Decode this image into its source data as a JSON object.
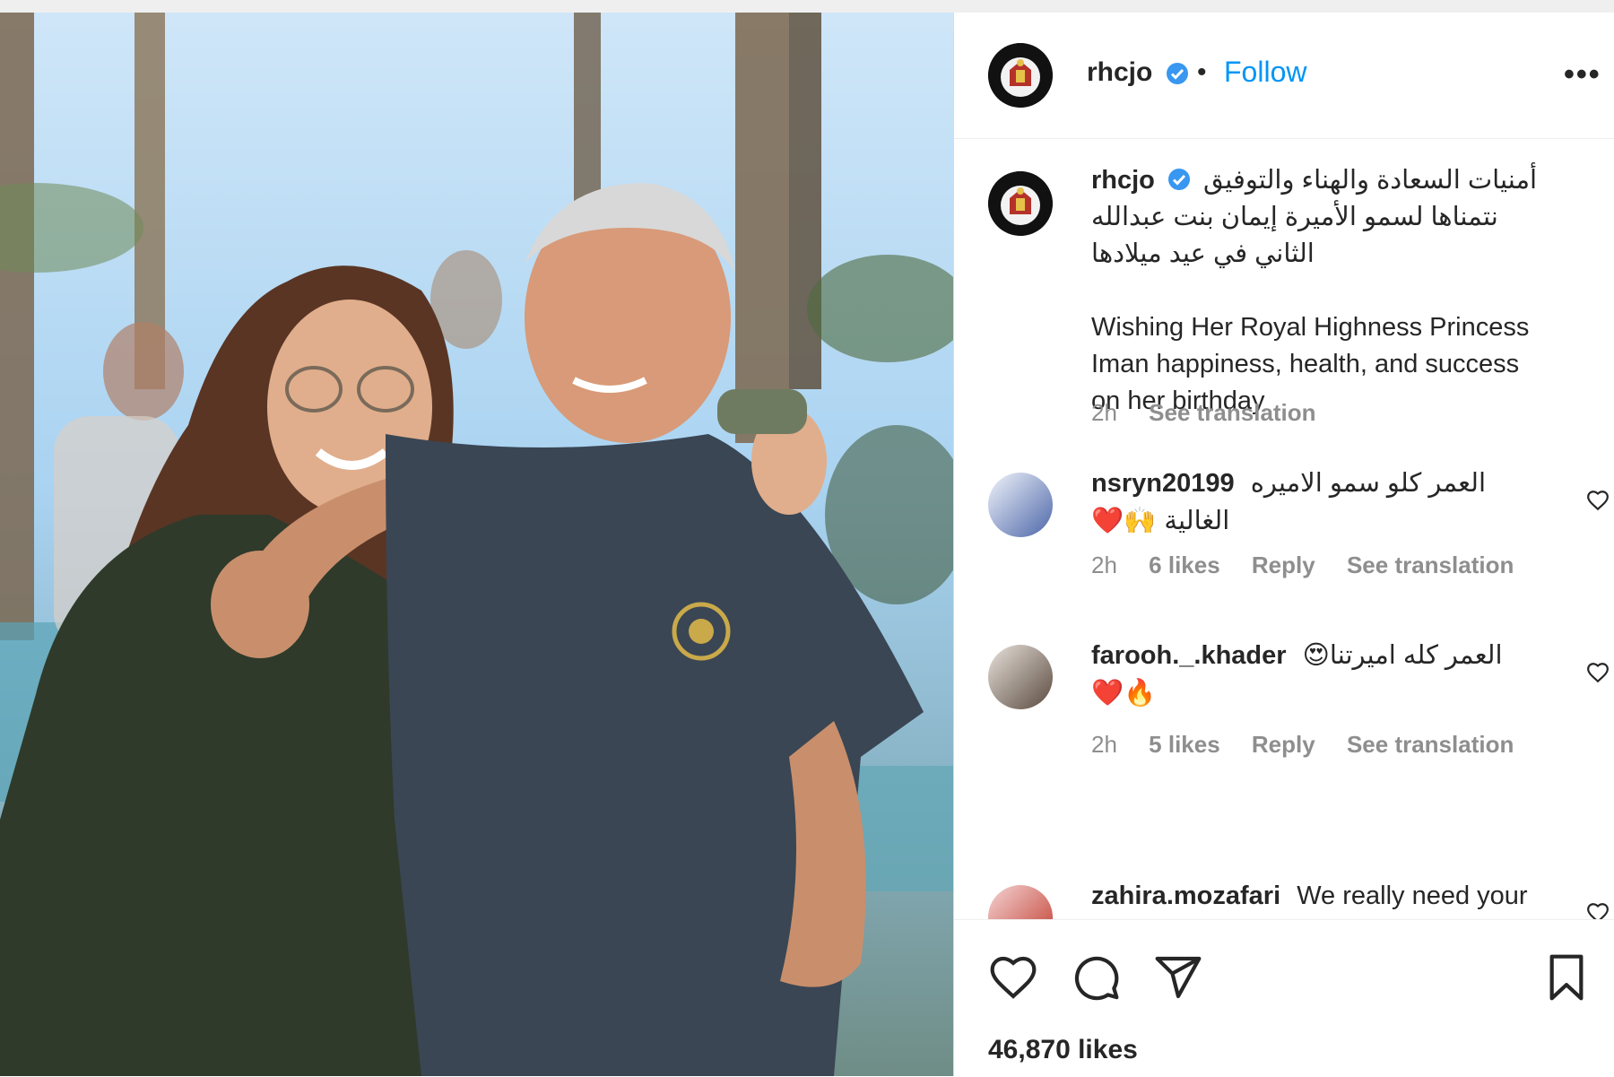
{
  "post": {
    "username": "rhcjo",
    "follow_label": "Follow",
    "more_label": "•••",
    "separator": "•"
  },
  "caption": {
    "username": "rhcjo",
    "arabic_lines": [
      "أمنيات السعادة والهناء والتوفيق",
      "نتمناها لسمو الأميرة إيمان بنت عبدالله",
      "الثاني في عيد ميلادها"
    ],
    "english_lines": [
      "Wishing Her Royal Highness Princess",
      "Iman happiness, health, and success",
      "on her birthday"
    ],
    "time": "2h",
    "see_translation": "See translation"
  },
  "comments": [
    {
      "username": "nsryn20199",
      "text_line1": "العمر كلو سمو الاميره",
      "text_line2": "الغالية 🙌❤️",
      "time": "2h",
      "likes": "6 likes",
      "reply": "Reply",
      "see_translation": "See translation"
    },
    {
      "username": "farooh._.khader",
      "text_line1": "العمر كله اميرتنا😍",
      "text_line2": "❤️🔥",
      "time": "2h",
      "likes": "5 likes",
      "reply": "Reply",
      "see_translation": "See translation"
    },
    {
      "username": "zahira.mozafari",
      "text_line1": "We really need your"
    }
  ],
  "actions": {
    "likes_count": "46,870 likes",
    "like_icon": "heart-icon",
    "comment_icon": "comment-icon",
    "share_icon": "share-icon",
    "save_icon": "bookmark-icon"
  },
  "colors": {
    "link": "#0095f6",
    "verified": "#3897f0",
    "secondary_text": "#8e8e8e",
    "primary_text": "#262626"
  }
}
